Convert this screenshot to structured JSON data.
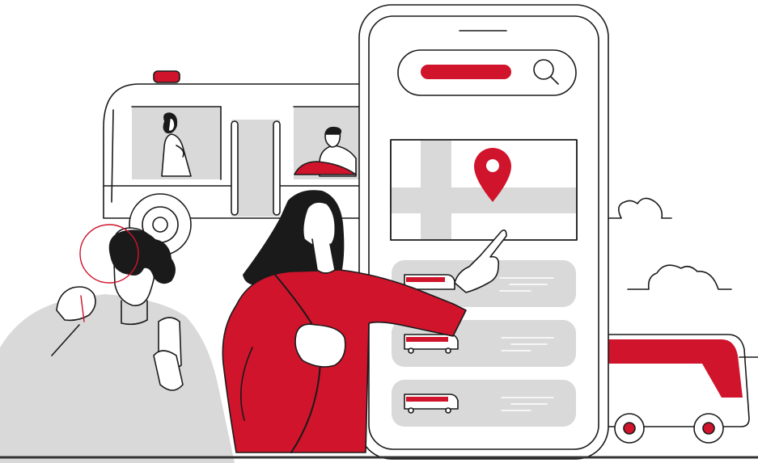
{
  "illustration": {
    "colors": {
      "accent": "#D0142C",
      "outline": "#1A1A1A",
      "neutral": "#D9D9D9",
      "background": "#FFFFFF"
    },
    "phone": {
      "search_bar_icon": "search-icon",
      "map_pin_icon": "map-pin-icon",
      "results": [
        {
          "icon": "bus-icon"
        },
        {
          "icon": "bus-icon"
        },
        {
          "icon": "bus-icon"
        }
      ]
    },
    "scene_icons": [
      "bus-icon",
      "coach-icon",
      "cloud-icon",
      "magnifier-icon"
    ]
  }
}
